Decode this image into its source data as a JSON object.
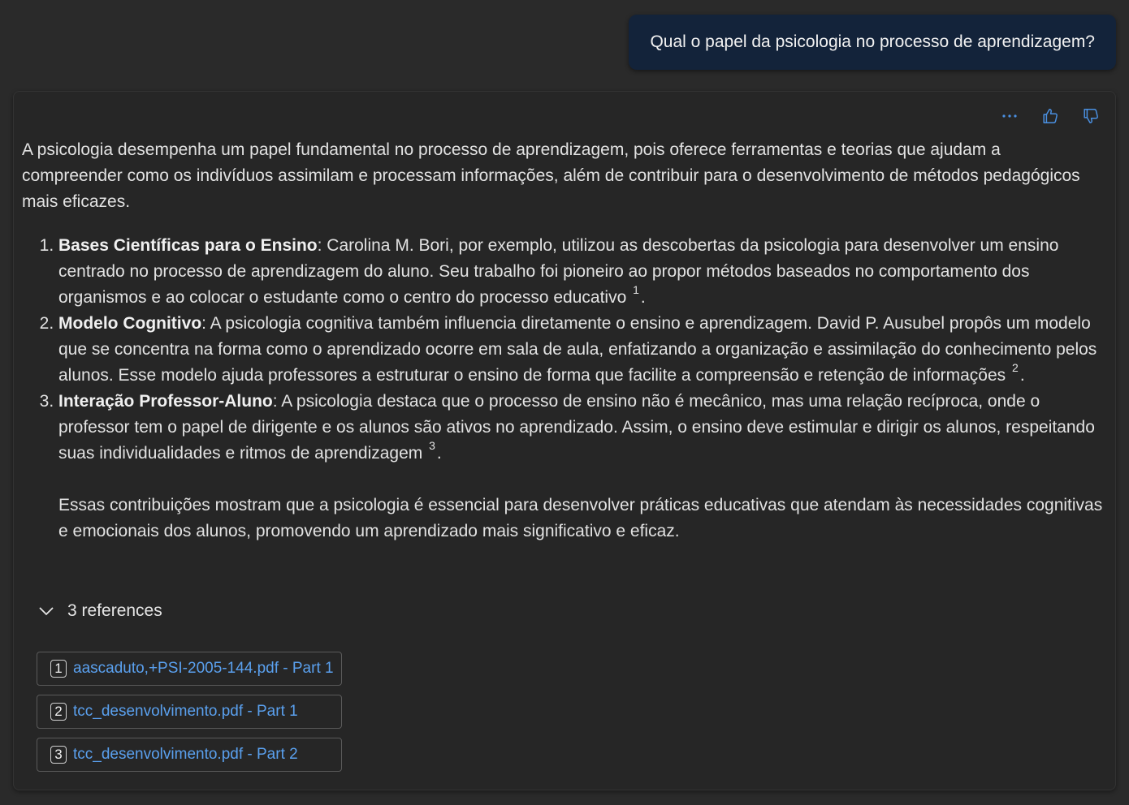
{
  "user_message": "Qual o papel da psicologia no processo de aprendizagem?",
  "toolbar": {
    "more_icon": "more-dots-icon",
    "like_icon": "thumbs-up-icon",
    "dislike_icon": "thumbs-down-icon",
    "accent_color": "#4a90e2"
  },
  "answer": {
    "intro": "A psicologia desempenha um papel fundamental no processo de aprendizagem, pois oferece ferramentas e teorias que ajudam a compreender como os indivíduos assimilam e processam informações, além de contribuir para o desenvolvimento de métodos pedagógicos mais eficazes.",
    "points": [
      {
        "title": "Bases Científicas para o Ensino",
        "text": ": Carolina M. Bori, por exemplo, utilizou as descobertas da psicologia para desenvolver um ensino centrado no processo de aprendizagem do aluno. Seu trabalho foi pioneiro ao propor métodos baseados no comportamento dos organismos e ao colocar o estudante como o centro do processo educativo",
        "ref": "1",
        "end": "."
      },
      {
        "title": "Modelo Cognitivo",
        "text": ": A psicologia cognitiva também influencia diretamente o ensino e aprendizagem. David P. Ausubel propôs um modelo que se concentra na forma como o aprendizado ocorre em sala de aula, enfatizando a organização e assimilação do conhecimento pelos alunos. Esse modelo ajuda professores a estruturar o ensino de forma que facilite a compreensão e retenção de informações",
        "ref": "2",
        "end": "."
      },
      {
        "title": "Interação Professor-Aluno",
        "text": ": A psicologia destaca que o processo de ensino não é mecânico, mas uma relação recíproca, onde o professor tem o papel de dirigente e os alunos são ativos no aprendizado. Assim, o ensino deve estimular e dirigir os alunos, respeitando suas individualidades e ritmos de aprendizagem",
        "ref": "3",
        "end": "."
      }
    ],
    "closing": "Essas contribuições mostram que a psicologia é essencial para desenvolver práticas educativas que atendam às necessidades cognitivas e emocionais dos alunos, promovendo um aprendizado mais significativo e eficaz."
  },
  "references": {
    "toggle_label": "3 references",
    "toggle_icon": "chevron-down-icon",
    "items": [
      {
        "num": "1",
        "label": "aascaduto,+PSI-2005-144.pdf - Part 1"
      },
      {
        "num": "2",
        "label": "tcc_desenvolvimento.pdf - Part 1"
      },
      {
        "num": "3",
        "label": "tcc_desenvolvimento.pdf - Part 2"
      }
    ],
    "link_color": "#5aa0ee"
  }
}
